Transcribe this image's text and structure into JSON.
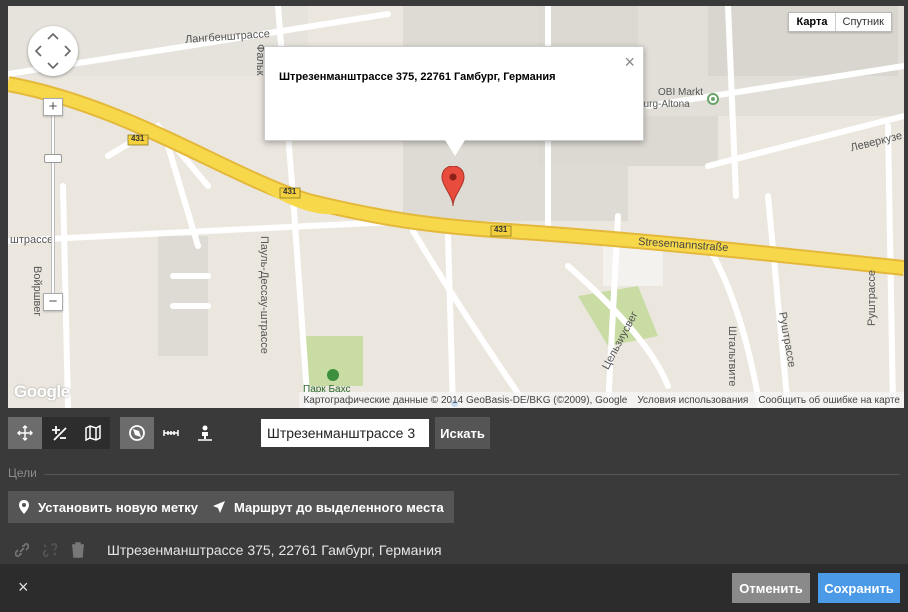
{
  "map": {
    "type_toggle": {
      "map_label": "Карта",
      "satellite_label": "Спутник"
    },
    "street_labels": {
      "langenbek": "Лангбенштрассе",
      "stresemann": "Stresemannstraße",
      "road_431": "431",
      "woyrsch": "Войршвег",
      "paul_dessau": "Пауль-Дессау-штрассе",
      "celsius": "Цельзиусвег",
      "leverkusen": "Леверкузе",
      "ruhr": "Руштрассе",
      "ruhr2": "Руштрассе",
      "stahl": "Штальтвите",
      "strasse_left": "штрассе",
      "falken": "Фальк",
      "park": "Парк Бахс",
      "obi": "OBI Markt",
      "obi2": "burg-Altona"
    },
    "infowindow": {
      "address": "Штрезенманштрассе 375, 22761 Гамбург, Германия",
      "close_glyph": "×"
    },
    "google_logo": "Google",
    "attribution": {
      "data": "Картографические данные © 2014 GeoBasis-DE/BKG (©2009), Google",
      "terms": "Условия использования",
      "report": "Сообщить об ошибке на карте"
    },
    "zoom": {
      "plus": "+",
      "minus": "−"
    }
  },
  "toolbar": {
    "search_value": "Штрезенманштрассе 3",
    "search_button": "Искать"
  },
  "goals": {
    "label": "Цели",
    "set_marker": "Установить новую метку",
    "route": "Маршрут до выделенного места"
  },
  "result": {
    "address": "Штрезенманштрассе 375, 22761 Гамбург, Германия"
  },
  "footer": {
    "close_glyph": "×",
    "cancel": "Отменить",
    "save": "Сохранить"
  },
  "colors": {
    "accent": "#4a9ae8",
    "road_major": "#f7d84a",
    "map_bg": "#ebe7df"
  }
}
